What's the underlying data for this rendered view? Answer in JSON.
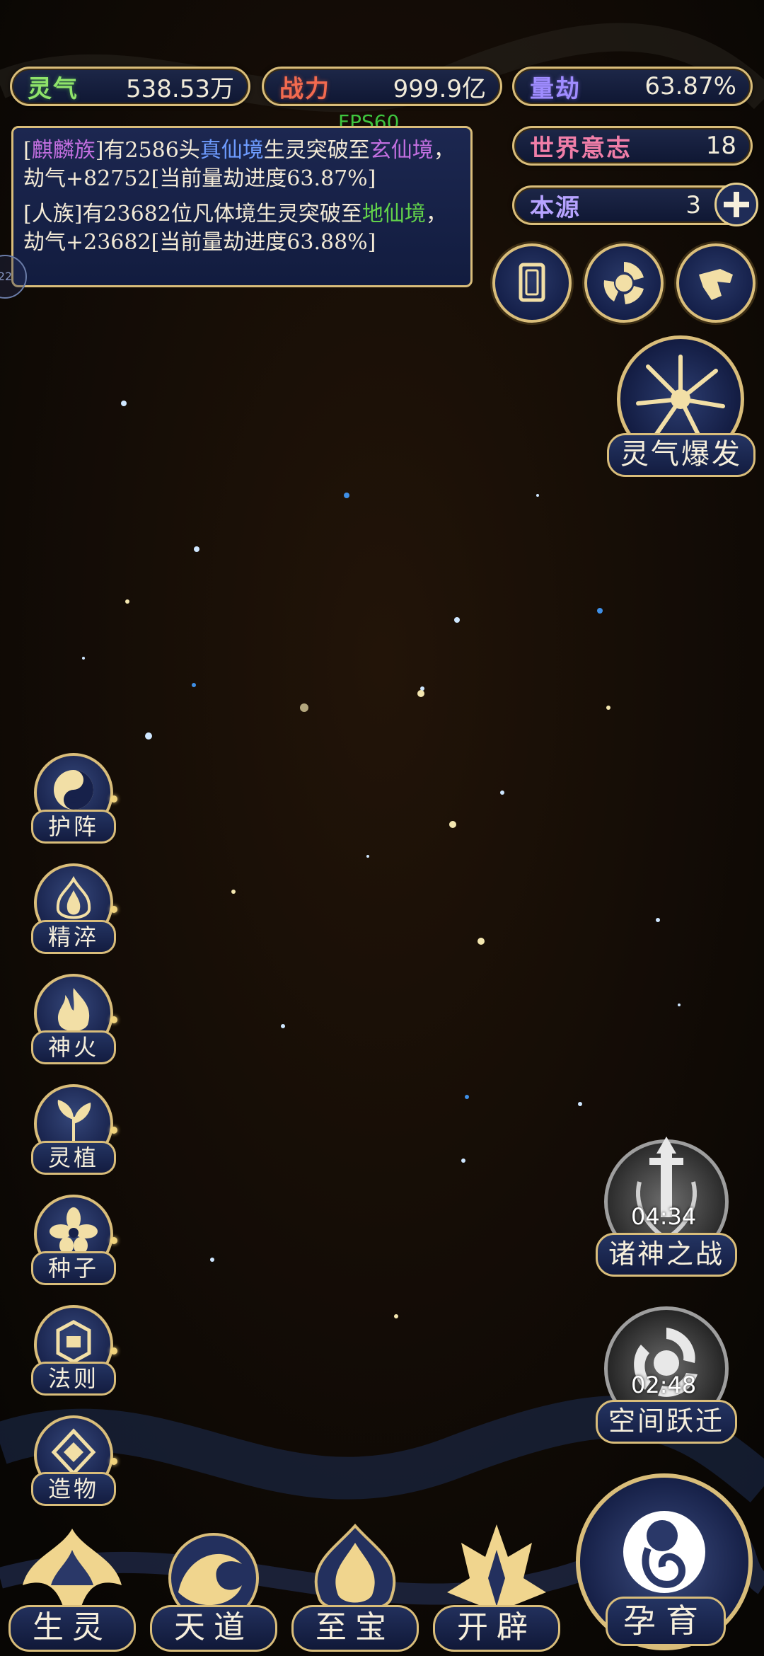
{
  "stats": {
    "lingqi": {
      "label": "灵气",
      "value": "538.53万"
    },
    "zhanli": {
      "label": "战力",
      "value": "999.9亿"
    },
    "liangjie": {
      "label": "量劫",
      "value": "63.87%"
    },
    "shijie": {
      "label": "世界意志",
      "value": "18"
    },
    "benyuan": {
      "label": "本源",
      "value": "3"
    }
  },
  "fps": "FPS60",
  "messages": {
    "m1": {
      "open": "[",
      "race": "麒麟族",
      "close": "]",
      "t1": "有2586头",
      "realm1": "真仙境",
      "t2": "生灵突破至",
      "realm2": "玄仙境",
      "t3": "，劫气+82752[当前量劫进度63.87%]"
    },
    "m2": {
      "t1": "[人族]有23682位凡体境生灵突破至",
      "realm": "地仙境",
      "t2": "，劫气+23682[当前量劫进度63.88%]"
    }
  },
  "side_handle": "22",
  "burst": {
    "label": "灵气爆发"
  },
  "skills": [
    {
      "label": "护阵",
      "icon": "taiji-icon"
    },
    {
      "label": "精淬",
      "icon": "flame-lotus-icon"
    },
    {
      "label": "神火",
      "icon": "fire-icon"
    },
    {
      "label": "灵植",
      "icon": "plant-icon"
    },
    {
      "label": "种子",
      "icon": "flower-icon"
    },
    {
      "label": "法则",
      "icon": "rune-icon"
    },
    {
      "label": "造物",
      "icon": "diamond-icon"
    }
  ],
  "events": {
    "war": {
      "label": "诸神之战",
      "timer": "04:34"
    },
    "jump": {
      "label": "空间跃迁",
      "timer": "02:48"
    }
  },
  "nav": {
    "shengling": "生灵",
    "tiandao": "天道",
    "zhibao": "至宝",
    "kaipi": "开辟",
    "yunyu": "孕育"
  },
  "colors": {
    "gold": "#d9bd7a",
    "panel": "#131c40"
  }
}
